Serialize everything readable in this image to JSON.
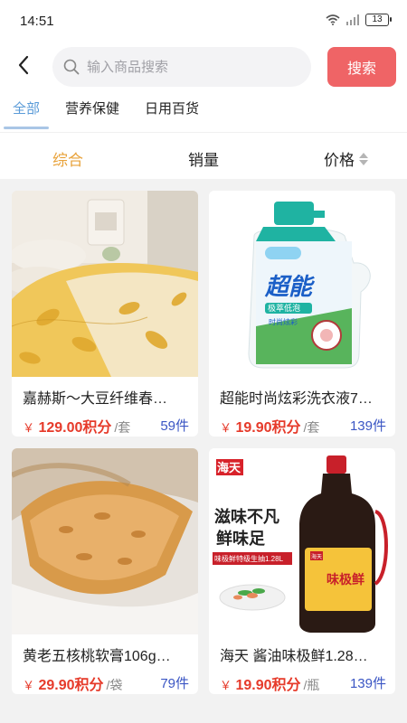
{
  "status": {
    "time": "14:51",
    "battery": "13"
  },
  "search": {
    "placeholder": "输入商品搜索",
    "button_label": "搜索"
  },
  "categories": [
    {
      "label": "全部",
      "active": true
    },
    {
      "label": "营养保健",
      "active": false
    },
    {
      "label": "日用百货",
      "active": false
    }
  ],
  "sort": [
    {
      "label": "综合",
      "active": true
    },
    {
      "label": "销量",
      "active": false
    },
    {
      "label": "价格",
      "active": false
    }
  ],
  "products": [
    {
      "name": "嘉赫斯～大豆纤维春…",
      "currency": "￥",
      "price": "129.00积分",
      "unit": "/套",
      "count": "59件",
      "image": "quilt"
    },
    {
      "name": "超能时尚炫彩洗衣液7…",
      "currency": "￥",
      "price": "19.90积分",
      "unit": "/套",
      "count": "139件",
      "image": "detergent",
      "image_text": {
        "brand": "超能",
        "tag": "极萃低泡",
        "sub": "时尚炫彩"
      }
    },
    {
      "name": "黄老五核桃软膏106g…",
      "currency": "￥",
      "price": "29.90积分",
      "unit": "/袋",
      "count": "79件",
      "image": "walnut-cake"
    },
    {
      "name": "海天 酱油味极鲜1.28…",
      "currency": "￥",
      "price": "19.90积分",
      "unit": "/瓶",
      "count": "139件",
      "image": "soy-sauce",
      "image_text": {
        "brand": "海天",
        "slogan_1": "滋味不凡",
        "slogan_2": "鲜味足",
        "product_line": "味极鲜特级生抽1.28L",
        "label_top": "海天",
        "label_main": "味极鲜"
      }
    }
  ],
  "colors": {
    "accent_blue": "#5a9bd8",
    "sort_active": "#e8a23a",
    "price_red": "#e63a2a",
    "count_blue": "#3b56c4",
    "search_button": "#ef6466"
  }
}
